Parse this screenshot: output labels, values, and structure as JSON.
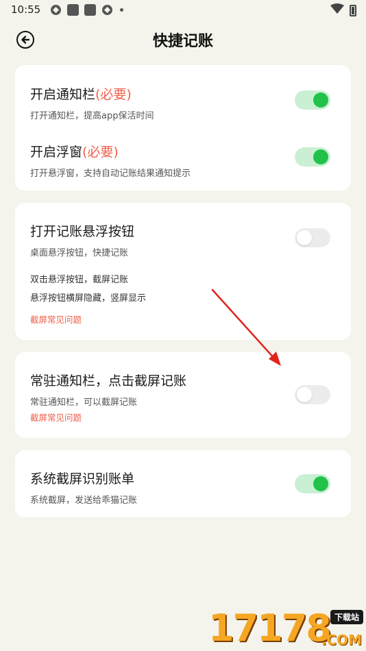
{
  "status_bar": {
    "time": "10:55"
  },
  "header": {
    "title": "快捷记账"
  },
  "card1": {
    "row1": {
      "title": "开启通知栏",
      "required": "(必要)",
      "desc": "打开通知栏，提高app保活时间",
      "enabled": true
    },
    "row2": {
      "title": "开启浮窗",
      "required": "(必要)",
      "desc": "打开悬浮窗，支持自动记账结果通知提示",
      "enabled": true
    }
  },
  "card2": {
    "title": "打开记账悬浮按钮",
    "desc": "桌面悬浮按钮，快捷记账",
    "enabled": false,
    "note1": "双击悬浮按钮，截屏记账",
    "note2": "悬浮按钮横屏隐藏，竖屏显示",
    "link": "截屏常见问题"
  },
  "card3": {
    "title": "常驻通知栏，点击截屏记账",
    "desc": "常驻通知栏，可以截屏记账",
    "enabled": false,
    "link": "截屏常见问题"
  },
  "card4": {
    "title": "系统截屏识别账单",
    "desc": "系统截屏，发送给乖猫记账",
    "enabled": true
  },
  "watermark": {
    "number": "17178",
    "badge": "下载站",
    "suffix": ".COM"
  },
  "colors": {
    "accent_green": "#22c24a",
    "accent_red": "#f0604c",
    "background": "#f4f4ec"
  }
}
